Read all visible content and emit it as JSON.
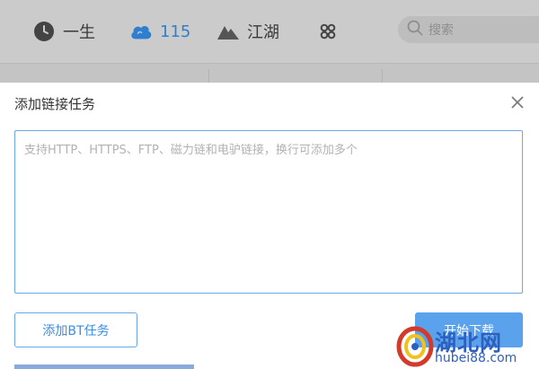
{
  "nav": {
    "items": [
      {
        "label": "一生",
        "icon": "clock-icon"
      },
      {
        "label": "115",
        "icon": "cloud-icon"
      },
      {
        "label": "江湖",
        "icon": "mountain-icon"
      },
      {
        "label": "",
        "icon": "apps-grid-icon"
      }
    ],
    "active_color": "#2f7fd0",
    "search_placeholder": "搜索"
  },
  "dialog": {
    "title": "添加链接任务",
    "input_placeholder": "支持HTTP、HTTPS、FTP、磁力链和电驴链接，换行可添加多个",
    "input_value": "",
    "bt_button_label": "添加BT任务",
    "start_button_label": "开始下载",
    "accent_color": "#5aa2ec"
  },
  "watermark": {
    "logo_text": "湖北网",
    "sub_text": "hubei88.com"
  }
}
